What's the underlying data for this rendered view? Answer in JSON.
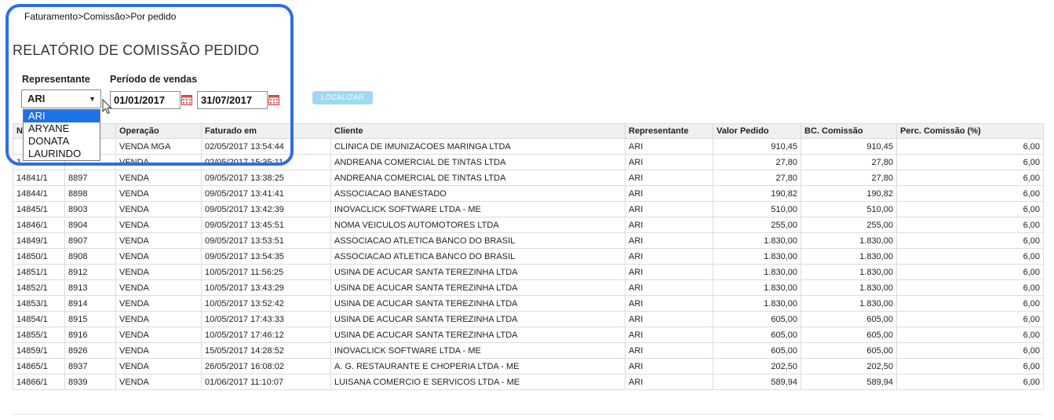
{
  "breadcrumb": "Faturamento>Comissão>Por pedido",
  "title": "RELATÓRIO DE COMISSÃO PEDIDO",
  "filters": {
    "representante_label": "Representante",
    "periodo_label": "Período de vendas",
    "representante_value": "ARI",
    "date_from": "01/01/2017",
    "date_to": "31/07/2017",
    "search_button": "LOCALIZAR",
    "dropdown_options": [
      "ARI",
      "ARYANE",
      "DONATA",
      "LAURINDO"
    ]
  },
  "table": {
    "columns": [
      "N",
      "",
      "Operação",
      "Faturado em",
      "Cliente",
      "Representante",
      "Valor Pedido",
      "BC. Comissão",
      "Perc. Comissão (%)"
    ],
    "rows": [
      [
        "",
        "",
        "VENDA MGA",
        "02/05/2017 13:54:44",
        "CLINICA DE IMUNIZACOES MARINGA LTDA",
        "ARI",
        "910,45",
        "910,45",
        "6,00"
      ],
      [
        "1",
        "",
        "VENDA",
        "02/05/2017 15:35:11",
        "ANDREANA COMERCIAL DE TINTAS LTDA",
        "ARI",
        "27,80",
        "27,80",
        "6,00"
      ],
      [
        "14841/1",
        "8897",
        "VENDA",
        "09/05/2017 13:38:25",
        "ANDREANA COMERCIAL DE TINTAS LTDA",
        "ARI",
        "27,80",
        "27,80",
        "6,00"
      ],
      [
        "14844/1",
        "8898",
        "VENDA",
        "09/05/2017 13:41:41",
        "ASSOCIACAO BANESTADO",
        "ARI",
        "190,82",
        "190,82",
        "6,00"
      ],
      [
        "14845/1",
        "8903",
        "VENDA",
        "09/05/2017 13:42:39",
        "INOVACLICK SOFTWARE LTDA - ME",
        "ARI",
        "510,00",
        "510,00",
        "6,00"
      ],
      [
        "14846/1",
        "8904",
        "VENDA",
        "09/05/2017 13:45:51",
        "NOMA VEICULOS AUTOMOTORES LTDA",
        "ARI",
        "255,00",
        "255,00",
        "6,00"
      ],
      [
        "14849/1",
        "8907",
        "VENDA",
        "09/05/2017 13:53:51",
        "ASSOCIACAO ATLETICA BANCO DO BRASIL",
        "ARI",
        "1.830,00",
        "1.830,00",
        "6,00"
      ],
      [
        "14850/1",
        "8908",
        "VENDA",
        "09/05/2017 13:54:35",
        "ASSOCIACAO ATLETICA BANCO DO BRASIL",
        "ARI",
        "1.830,00",
        "1.830,00",
        "6,00"
      ],
      [
        "14851/1",
        "8912",
        "VENDA",
        "10/05/2017 11:56:25",
        "USINA DE ACUCAR SANTA TEREZINHA LTDA",
        "ARI",
        "1.830,00",
        "1.830,00",
        "6,00"
      ],
      [
        "14852/1",
        "8913",
        "VENDA",
        "10/05/2017 13:43:29",
        "USINA DE ACUCAR SANTA TEREZINHA LTDA",
        "ARI",
        "1.830,00",
        "1.830,00",
        "6,00"
      ],
      [
        "14853/1",
        "8914",
        "VENDA",
        "10/05/2017 13:52:42",
        "USINA DE ACUCAR SANTA TEREZINHA LTDA",
        "ARI",
        "1.830,00",
        "1.830,00",
        "6,00"
      ],
      [
        "14854/1",
        "8915",
        "VENDA",
        "10/05/2017 17:43:33",
        "USINA DE ACUCAR SANTA TEREZINHA LTDA",
        "ARI",
        "605,00",
        "605,00",
        "6,00"
      ],
      [
        "14855/1",
        "8916",
        "VENDA",
        "10/05/2017 17:46:12",
        "USINA DE ACUCAR SANTA TEREZINHA LTDA",
        "ARI",
        "605,00",
        "605,00",
        "6,00"
      ],
      [
        "14859/1",
        "8926",
        "VENDA",
        "15/05/2017 14:28:52",
        "INOVACLICK SOFTWARE LTDA - ME",
        "ARI",
        "605,00",
        "605,00",
        "6,00"
      ],
      [
        "14865/1",
        "8937",
        "VENDA",
        "26/05/2017 16:08:02",
        "A. G. RESTAURANTE E CHOPERIA LTDA - ME",
        "ARI",
        "202,50",
        "202,50",
        "6,00"
      ],
      [
        "14866/1",
        "8939",
        "VENDA",
        "01/06/2017 11:10:07",
        "LUISANA COMERCIO E SERVICOS LTDA - ME",
        "ARI",
        "589,94",
        "589,94",
        "6,00"
      ]
    ]
  },
  "colors": {
    "highlight": "#2e6ee6",
    "button": "#9fd9f4",
    "selected_option": "#1e73e8"
  }
}
